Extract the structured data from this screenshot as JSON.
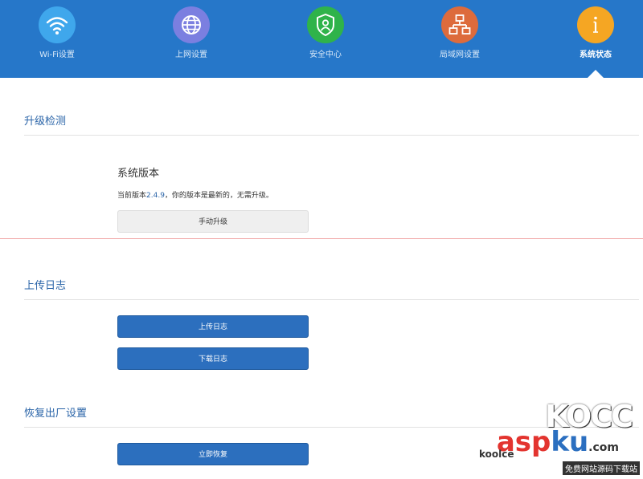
{
  "nav": {
    "items": [
      {
        "label": "Wi-Fi设置",
        "icon": "wifi-icon",
        "color": "#3fa7ec"
      },
      {
        "label": "上网设置",
        "icon": "globe-icon",
        "color": "#7b7fe0"
      },
      {
        "label": "安全中心",
        "icon": "shield-icon",
        "color": "#2fb34a"
      },
      {
        "label": "局域网设置",
        "icon": "network-icon",
        "color": "#dd6b3c"
      },
      {
        "label": "系统状态",
        "icon": "info-icon",
        "color": "#f5a623",
        "active": true
      }
    ],
    "bar_color": "#2677c9"
  },
  "upgrade": {
    "title": "升级检测",
    "subtitle": "系统版本",
    "status_prefix": "当前版本",
    "version": "2.4.9",
    "status_suffix": "，你的版本是最新的，无需升级。",
    "manual_button": "手动升级"
  },
  "logs": {
    "title": "上传日志",
    "upload_button": "上传日志",
    "download_button": "下载日志"
  },
  "factory": {
    "title": "恢复出厂设置",
    "restore_button": "立即恢复"
  },
  "watermark": {
    "brand": "KOCC",
    "asp": "asp",
    "ku": "ku",
    "domain": ".com",
    "koole": "koolce",
    "tagline": "免费网站源码下载站"
  }
}
